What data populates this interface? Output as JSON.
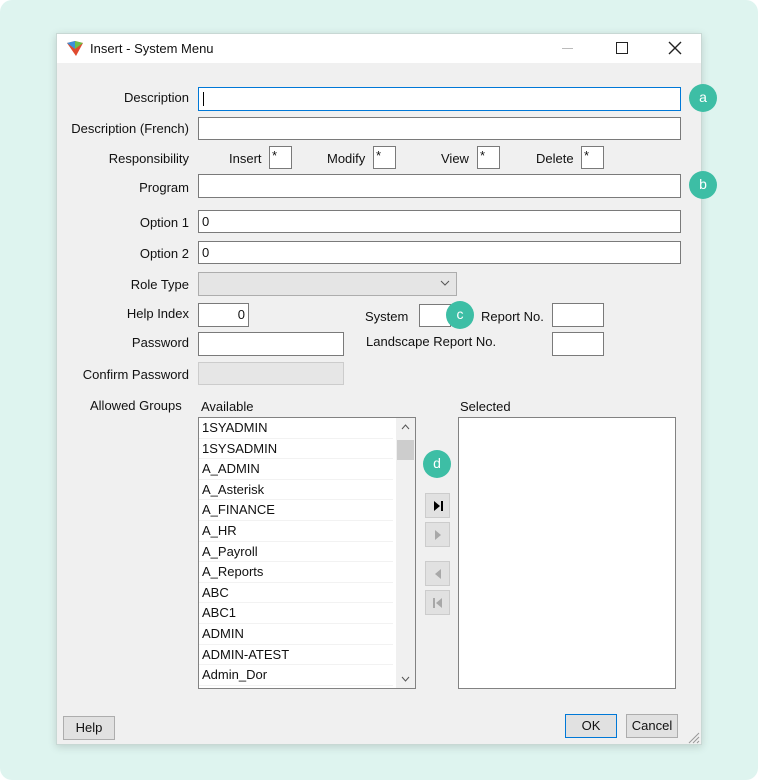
{
  "window": {
    "title": "Insert - System Menu"
  },
  "form": {
    "description_label": "Description",
    "description_value": "",
    "description_fr_label": "Description (French)",
    "description_fr_value": "",
    "responsibility_label": "Responsibility",
    "insert_label": "Insert",
    "insert_value": "*",
    "modify_label": "Modify",
    "modify_value": "*",
    "view_label": "View",
    "view_value": "*",
    "delete_label": "Delete",
    "delete_value": "*",
    "program_label": "Program",
    "program_value": "",
    "option1_label": "Option 1",
    "option1_value": "0",
    "option2_label": "Option 2",
    "option2_value": "0",
    "role_type_label": "Role Type",
    "role_type_value": "",
    "help_index_label": "Help Index",
    "help_index_value": "0",
    "system_label": "System",
    "system_value": "",
    "report_no_label": "Report No.",
    "report_no_value": "",
    "password_label": "Password",
    "landscape_label": "Landscape Report No.",
    "landscape_value": "",
    "confirm_password_label": "Confirm Password",
    "allowed_groups_label": "Allowed Groups",
    "available_label": "Available",
    "selected_label": "Selected",
    "available_items": [
      "1SYADMIN",
      "1SYSADMIN",
      "A_ADMIN",
      "A_Asterisk",
      "A_FINANCE",
      "A_HR",
      "A_Payroll",
      "A_Reports",
      "ABC",
      "ABC1",
      "ADMIN",
      "ADMIN-ATEST",
      "Admin_Dor"
    ]
  },
  "footer": {
    "help": "Help",
    "ok": "OK",
    "cancel": "Cancel"
  },
  "badges": {
    "a": "a",
    "b": "b",
    "c": "c",
    "d": "d"
  },
  "colors": {
    "badge": "#3dbea5",
    "focus": "#0078d7"
  }
}
